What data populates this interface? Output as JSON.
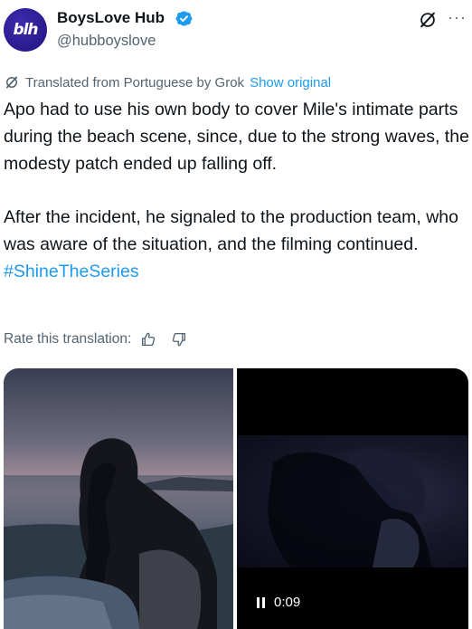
{
  "author": {
    "display_name": "BoysLove Hub",
    "handle": "@hubboyslove",
    "avatar_text": "blh",
    "verified": true
  },
  "translation": {
    "label": "Translated from Portuguese by Grok",
    "show_original": "Show original"
  },
  "tweet": {
    "paragraph1": "Apo had to use his own body to cover Mile's intimate parts during the beach scene, since, due to the strong waves, the modesty patch ended up falling off.",
    "paragraph2": "After the incident, he signaled to the production team, who was aware of the situation, and the filming continued.",
    "hashtag": "#ShineTheSeries"
  },
  "rating": {
    "label": "Rate this translation:"
  },
  "media": {
    "video_time": "0:09"
  },
  "colors": {
    "accent": "#1d9bf0",
    "text": "#0f1419",
    "secondary": "#536471",
    "avatar": "#2a1a8c"
  }
}
